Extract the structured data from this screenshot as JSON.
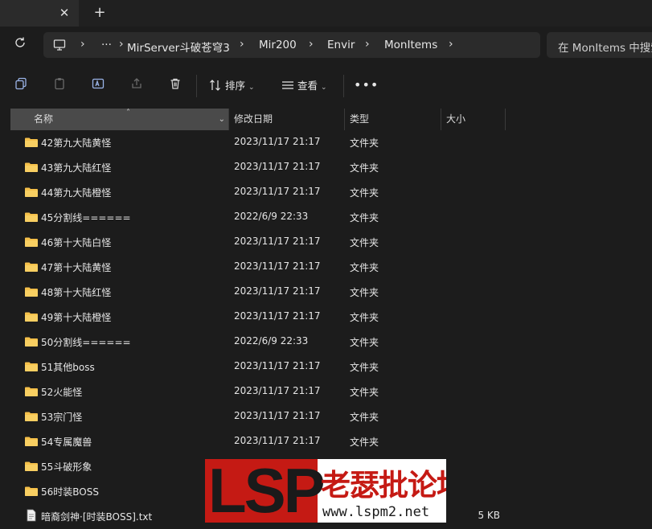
{
  "tabs": {
    "close_glyph": "✕",
    "new_tab_glyph": "+"
  },
  "address": {
    "more_glyph": "···",
    "crumbs": [
      "MirServer斗破苍穹3",
      "Mir200",
      "Envir",
      "MonItems"
    ]
  },
  "search": {
    "placeholder": "在 MonItems 中搜索"
  },
  "toolbar": {
    "sort_label": "排序",
    "view_label": "查看",
    "more_glyph": "•••"
  },
  "columns": {
    "name": "名称",
    "date": "修改日期",
    "type": "类型",
    "size": "大小"
  },
  "files": [
    {
      "name": "42第九大陆黄怪",
      "date": "2023/11/17 21:17",
      "type": "文件夹",
      "size": "",
      "kind": "folder"
    },
    {
      "name": "43第九大陆红怪",
      "date": "2023/11/17 21:17",
      "type": "文件夹",
      "size": "",
      "kind": "folder"
    },
    {
      "name": "44第九大陆橙怪",
      "date": "2023/11/17 21:17",
      "type": "文件夹",
      "size": "",
      "kind": "folder"
    },
    {
      "name": "45分割线======",
      "date": "2022/6/9 22:33",
      "type": "文件夹",
      "size": "",
      "kind": "folder"
    },
    {
      "name": "46第十大陆白怪",
      "date": "2023/11/17 21:17",
      "type": "文件夹",
      "size": "",
      "kind": "folder"
    },
    {
      "name": "47第十大陆黄怪",
      "date": "2023/11/17 21:17",
      "type": "文件夹",
      "size": "",
      "kind": "folder"
    },
    {
      "name": "48第十大陆红怪",
      "date": "2023/11/17 21:17",
      "type": "文件夹",
      "size": "",
      "kind": "folder"
    },
    {
      "name": "49第十大陆橙怪",
      "date": "2023/11/17 21:17",
      "type": "文件夹",
      "size": "",
      "kind": "folder"
    },
    {
      "name": "50分割线======",
      "date": "2022/6/9 22:33",
      "type": "文件夹",
      "size": "",
      "kind": "folder"
    },
    {
      "name": "51其他boss",
      "date": "2023/11/17 21:17",
      "type": "文件夹",
      "size": "",
      "kind": "folder"
    },
    {
      "name": "52火能怪",
      "date": "2023/11/17 21:17",
      "type": "文件夹",
      "size": "",
      "kind": "folder"
    },
    {
      "name": "53宗门怪",
      "date": "2023/11/17 21:17",
      "type": "文件夹",
      "size": "",
      "kind": "folder"
    },
    {
      "name": "54专属魔兽",
      "date": "2023/11/17 21:17",
      "type": "文件夹",
      "size": "",
      "kind": "folder"
    },
    {
      "name": "55斗破形象",
      "date": "",
      "type": "",
      "size": "",
      "kind": "folder"
    },
    {
      "name": "56时装BOSS",
      "date": "",
      "type": "",
      "size": "",
      "kind": "folder"
    },
    {
      "name": "暗裔剑神·[时装BOSS].txt",
      "date": "",
      "type": "",
      "size": "5 KB",
      "kind": "file"
    }
  ],
  "watermark": {
    "lsp": "LSP",
    "cn": "老瑟批论坛",
    "url": "www.lspm2.net"
  },
  "colors": {
    "folder": "#f5c04a",
    "accent": "#9ab4e8"
  }
}
